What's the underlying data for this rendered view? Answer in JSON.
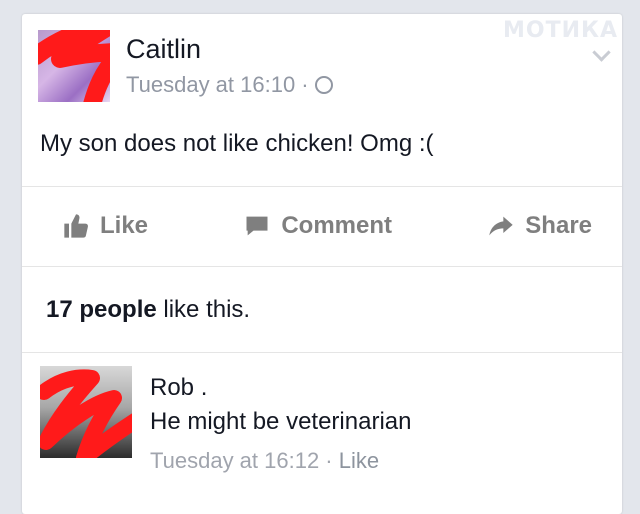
{
  "watermark": "МОТИКА",
  "post": {
    "author": "Caitlin",
    "timestamp": "Tuesday at 16:10 ·",
    "text": "My son does not like chicken! Omg :(",
    "privacy_icon": "globe-icon",
    "options_icon": "chevron-down-icon"
  },
  "actions": {
    "like_label": "Like",
    "comment_label": "Comment",
    "share_label": "Share"
  },
  "likes_summary": {
    "count_text": "17 people",
    "suffix": " like this."
  },
  "comment": {
    "author": "Rob",
    "suffix": " .",
    "text": "He might be veterinarian",
    "timestamp": "Tuesday at 16:12 · ",
    "like_label": "Like"
  },
  "colors": {
    "background": "#e3e6ec",
    "card": "#ffffff",
    "text": "#141823",
    "muted": "#9197a3",
    "scribble": "#ff1a1a"
  }
}
